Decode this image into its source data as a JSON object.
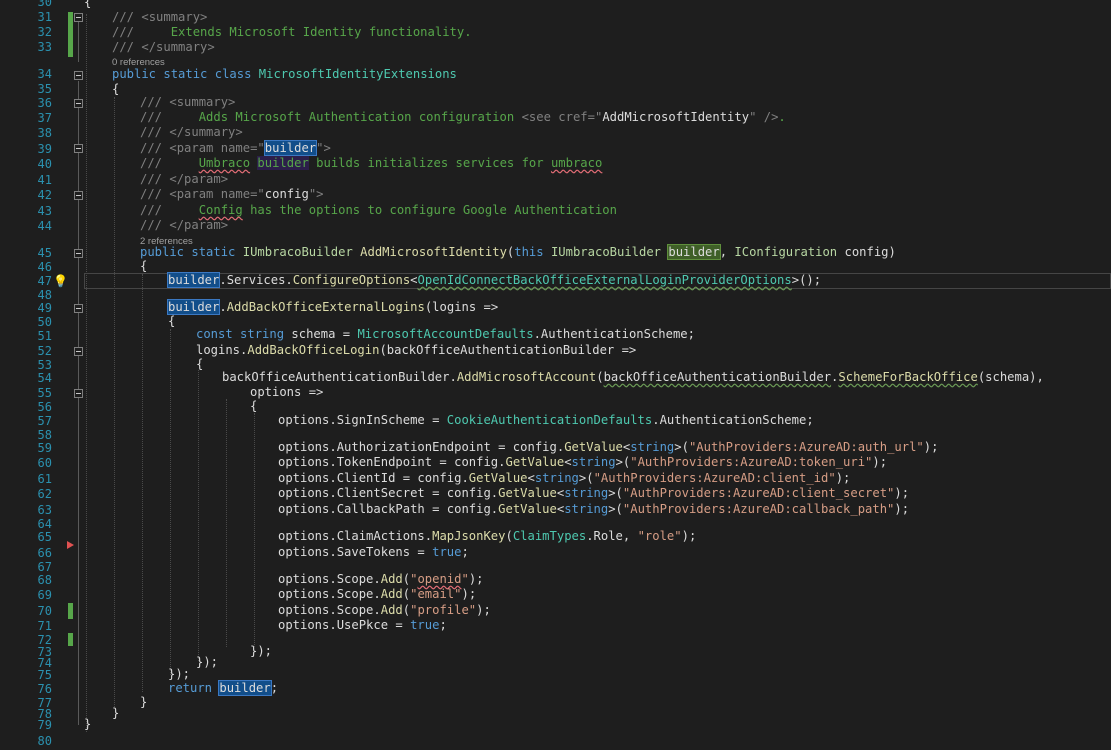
{
  "colors": {
    "background": "#1e1e1e",
    "line_number": "#2b91af",
    "comment": "#57a64a",
    "xml_tag": "#808080",
    "keyword": "#569cd6",
    "type": "#4ec9b0",
    "interface": "#b8d7a3",
    "method": "#dcdcaa",
    "string": "#d69d85",
    "change_added": "#57a64a",
    "breakpoint_arrow": "#e05252"
  },
  "icons": {
    "lightbulb": "lightbulb-icon",
    "fold": "collapse-minus-icon",
    "next_statement": "arrow-right-icon"
  },
  "line_numbers": [
    "30",
    "31",
    "32",
    "33",
    "34",
    "35",
    "36",
    "37",
    "38",
    "39",
    "40",
    "41",
    "42",
    "43",
    "44",
    "45",
    "46",
    "47",
    "48",
    "49",
    "50",
    "51",
    "52",
    "53",
    "54",
    "55",
    "56",
    "57",
    "58",
    "59",
    "60",
    "61",
    "62",
    "63",
    "64",
    "65",
    "66",
    "67",
    "68",
    "69",
    "70",
    "71",
    "72",
    "73",
    "74",
    "75",
    "76",
    "77",
    "78",
    "79",
    "80"
  ],
  "code_lens": {
    "class_refs": "0 references",
    "method_refs": "2 references"
  },
  "lines": {
    "l30": {
      "brace": "{"
    },
    "l31": {
      "slashes": "///",
      "tag": "<summary>"
    },
    "l32": {
      "slashes": "///",
      "text": "     Extends Microsoft Identity functionality."
    },
    "l33": {
      "slashes": "///",
      "tag": "</summary>"
    },
    "l34": {
      "kw1": "public",
      "kw2": "static",
      "kw3": "class",
      "name": "MicrosoftIdentityExtensions"
    },
    "l35": {
      "brace": "{"
    },
    "l36": {
      "slashes": "///",
      "tag": "<summary>"
    },
    "l37": {
      "slashes": "///",
      "text": "     Adds Microsoft Authentication configuration",
      "tag_open": "<see",
      "attr": "cref",
      "eq": "=\"",
      "val": "AddMicrosoftIdentity",
      "tag_close": "\" />",
      "dot": "."
    },
    "l38": {
      "slashes": "///",
      "tag": "</summary>"
    },
    "l39": {
      "slashes": "///",
      "tag_open": "<param",
      "attr": "name",
      "eq": "=\"",
      "val": "builder",
      "tag_close": "\">"
    },
    "l40": {
      "slashes": "///",
      "pre": "     ",
      "w1": "Umbraco",
      "w2": "builder",
      "w3": "builds initializes services for",
      "w4": "umbraco"
    },
    "l41": {
      "slashes": "///",
      "tag": "</param>"
    },
    "l42": {
      "slashes": "///",
      "tag_open": "<param",
      "attr": "name",
      "eq": "=\"",
      "val": "config",
      "tag_close": "\">"
    },
    "l43": {
      "slashes": "///",
      "pre": "     ",
      "w1": "Config",
      "w2": "has the options to configure Google Authentication"
    },
    "l44": {
      "slashes": "///",
      "tag": "</param>"
    },
    "l45": {
      "kw1": "public",
      "kw2": "static",
      "type1": "IUmbracoBuilder",
      "method": "AddMicrosoftIdentity",
      "p1": "(",
      "kw3": "this",
      "type2": "IUmbracoBuilder",
      "param1": "builder",
      "comma": ",",
      "type3": "IConfiguration",
      "param2": "config",
      "p2": ")"
    },
    "l46": {
      "brace": "{"
    },
    "l47": {
      "var": "builder",
      "dot1": ".",
      "prop": "Services",
      "dot2": ".",
      "method": "ConfigureOptions",
      "lt": "<",
      "type": "OpenIdConnectBackOfficeExternalLoginProviderOptions",
      "end": ">();"
    },
    "l48": {
      "text": ""
    },
    "l49": {
      "var": "builder",
      "dot": ".",
      "method": "AddBackOfficeExternalLogins",
      "rest": "(logins =>"
    },
    "l50": {
      "brace": "{"
    },
    "l51": {
      "kw1": "const",
      "kw2": "string",
      "name": "schema",
      "eq": " = ",
      "type": "MicrosoftAccountDefaults",
      "rest": ".AuthenticationScheme;"
    },
    "l52": {
      "var": "logins",
      "dot": ".",
      "method": "AddBackOfficeLogin",
      "rest": "(backOfficeAuthenticationBuilder =>"
    },
    "l53": {
      "brace": "{"
    },
    "l54": {
      "var": "backOfficeAuthenticationBuilder",
      "dot": ".",
      "method": "AddMicrosoftAccount",
      "p1": "(",
      "arg": "backOfficeAuthenticationBuilder",
      "dot2": ".",
      "method2": "SchemeForBackOffice",
      "rest": "(schema),"
    },
    "l55": {
      "text": "options =>"
    },
    "l56": {
      "brace": "{"
    },
    "l57": {
      "var": "options",
      "rest1": ".SignInScheme = ",
      "type": "CookieAuthenticationDefaults",
      "rest2": ".AuthenticationScheme;"
    },
    "l58": {
      "text": ""
    },
    "l59": {
      "var": "options",
      "rest1": ".AuthorizationEndpoint = config.",
      "method": "GetValue",
      "lt": "<",
      "kw": "string",
      "gt": ">(",
      "str": "\"AuthProviders:AzureAD:auth_url\"",
      "end": ");"
    },
    "l60": {
      "var": "options",
      "rest1": ".TokenEndpoint = config.",
      "method": "GetValue",
      "lt": "<",
      "kw": "string",
      "gt": ">(",
      "str": "\"AuthProviders:AzureAD:token_uri\"",
      "end": ");"
    },
    "l61": {
      "var": "options",
      "rest1": ".ClientId = config.",
      "method": "GetValue",
      "lt": "<",
      "kw": "string",
      "gt": ">(",
      "str": "\"AuthProviders:AzureAD:client_id\"",
      "end": ");"
    },
    "l62": {
      "var": "options",
      "rest1": ".ClientSecret = config.",
      "method": "GetValue",
      "lt": "<",
      "kw": "string",
      "gt": ">(",
      "str": "\"AuthProviders:AzureAD:client_secret\"",
      "end": ");"
    },
    "l63": {
      "var": "options",
      "rest1": ".CallbackPath = config.",
      "method": "GetValue",
      "lt": "<",
      "kw": "string",
      "gt": ">(",
      "str": "\"AuthProviders:AzureAD:callback_path\"",
      "end": ");"
    },
    "l64": {
      "text": ""
    },
    "l65": {
      "var": "options",
      "rest1": ".ClaimActions.",
      "method": "MapJsonKey",
      "p1": "(",
      "type": "ClaimTypes",
      "rest2": ".Role, ",
      "str": "\"role\"",
      "end": ");"
    },
    "l66": {
      "var": "options",
      "rest1": ".SaveTokens = ",
      "kw": "true",
      "end": ";"
    },
    "l67": {
      "text": ""
    },
    "l68": {
      "var": "options",
      "rest1": ".Scope.",
      "method": "Add",
      "p1": "(",
      "q1": "\"",
      "word": "openid",
      "q2": "\"",
      "end": ");"
    },
    "l69": {
      "var": "options",
      "rest1": ".Scope.",
      "method": "Add",
      "p1": "(",
      "str": "\"email\"",
      "end": ");"
    },
    "l70": {
      "var": "options",
      "rest1": ".Scope.",
      "method": "Add",
      "p1": "(",
      "str": "\"profile\"",
      "end": ");"
    },
    "l71": {
      "var": "options",
      "rest1": ".UsePkce = ",
      "kw": "true",
      "end": ";"
    },
    "l72": {
      "text": ""
    },
    "l73": {
      "text": "});"
    },
    "l74": {
      "text": "});"
    },
    "l75": {
      "text": "});"
    },
    "l76": {
      "kw": "return",
      "sp": " ",
      "var": "builder",
      "end": ";"
    },
    "l77": {
      "brace": "}"
    },
    "l78": {
      "brace": "}"
    },
    "l79": {
      "brace": "}"
    },
    "l80": {
      "text": ""
    }
  }
}
